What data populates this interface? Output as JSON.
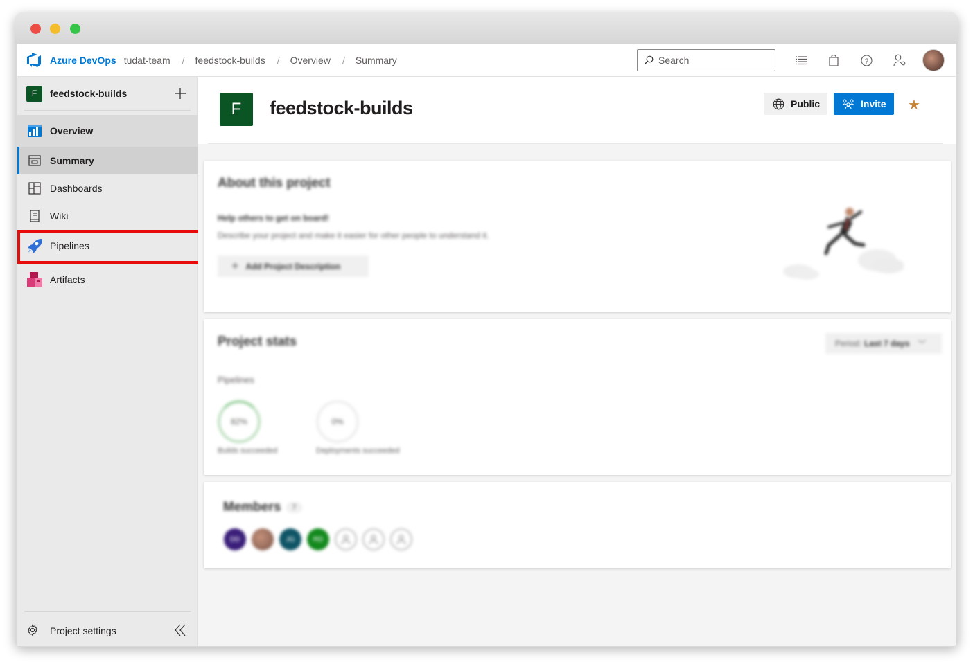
{
  "header": {
    "brand": "Azure DevOps",
    "breadcrumb": [
      "tudat-team",
      "feedstock-builds",
      "Overview",
      "Summary"
    ],
    "search_placeholder": "Search",
    "icons": [
      "search-icon",
      "settings-list-icon",
      "shopping-bag-icon",
      "help-icon",
      "user-settings-icon",
      "avatar"
    ]
  },
  "sidebar": {
    "project_initial": "F",
    "project_name": "feedstock-builds",
    "items": [
      {
        "label": "Overview",
        "icon": "overview-icon"
      },
      {
        "label": "Summary",
        "icon": "summary-icon"
      },
      {
        "label": "Dashboards",
        "icon": "dashboards-icon"
      },
      {
        "label": "Wiki",
        "icon": "wiki-icon"
      },
      {
        "label": "Pipelines",
        "icon": "pipelines-icon"
      },
      {
        "label": "Artifacts",
        "icon": "artifacts-icon"
      }
    ],
    "settings_label": "Project settings",
    "highlight_color": "#e80b0b"
  },
  "main": {
    "project_initial": "F",
    "title": "feedstock-builds",
    "public_label": "Public",
    "invite_label": "Invite",
    "star_color": "#c8823a",
    "about": {
      "title": "About this project",
      "help": "Help others to get on board!",
      "description": "Describe your project and make it easier for other people to understand it.",
      "add_button": "Add Project Description"
    },
    "stats": {
      "title": "Project stats",
      "period_label": "Period:",
      "period_value": "Last 7 days",
      "pipelines_label": "Pipelines",
      "builds_pct": "82%",
      "builds_caption": "Builds succeeded",
      "deploy_pct": "0%",
      "deploy_caption": "Deployments succeeded"
    },
    "members": {
      "title": "Members",
      "count": "7",
      "avatars": [
        {
          "initials": "DD",
          "color": "#3b1f7a"
        },
        {
          "initials": "",
          "color": "#9a6b55"
        },
        {
          "initials": "JG",
          "color": "#0f5566"
        },
        {
          "initials": "RD",
          "color": "#138a1e"
        },
        {
          "initials": "",
          "color": "#ffffff"
        },
        {
          "initials": "",
          "color": "#ffffff"
        },
        {
          "initials": "",
          "color": "#ffffff"
        }
      ]
    }
  },
  "colors": {
    "accent": "#0078d4",
    "project_tile": "#0b5524"
  }
}
